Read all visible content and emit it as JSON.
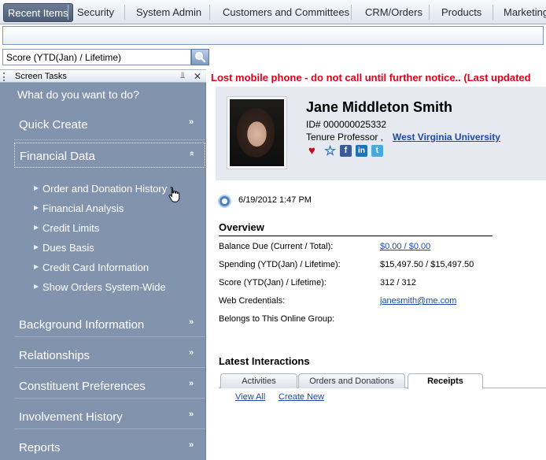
{
  "nav": {
    "tabs": [
      {
        "label": "Recent Items",
        "active": true
      },
      {
        "label": "Security"
      },
      {
        "label": "System Admin"
      },
      {
        "label": "Customers and Committees"
      },
      {
        "label": "CRM/Orders"
      },
      {
        "label": "Products"
      },
      {
        "label": "Marketing"
      }
    ]
  },
  "search": {
    "value": "Score (YTD(Jan) / Lifetime)",
    "icon": "search-icon"
  },
  "tasks": {
    "title": "Screen Tasks",
    "prompt": "What do you want to do?",
    "sections": [
      {
        "label": "Quick Create",
        "expanded": false
      },
      {
        "label": "Financial Data",
        "expanded": true,
        "items": [
          "Order and Donation History",
          "Financial Analysis",
          "Credit Limits",
          "Dues Basis",
          "Credit Card Information",
          "Show Orders System-Wide"
        ]
      },
      {
        "label": "Background Information",
        "expanded": false
      },
      {
        "label": "Relationships",
        "expanded": false
      },
      {
        "label": "Constituent Preferences",
        "expanded": false
      },
      {
        "label": "Involvement History",
        "expanded": false
      },
      {
        "label": "Reports",
        "expanded": false
      }
    ]
  },
  "alert": "Lost mobile phone - do not call until further notice.. (Last updated",
  "profile": {
    "name": "Jane Middleton Smith",
    "id_line": "ID# 000000025332",
    "title_line": "Tenure Professor ,",
    "organization": "West Virginia University",
    "social_icons": [
      "heart-icon",
      "star-icon",
      "facebook-icon",
      "linkedin-icon",
      "twitter-icon"
    ]
  },
  "last_updated": "6/19/2012 1:47 PM",
  "overview": {
    "title": "Overview",
    "rows": [
      {
        "label": "Balance Due (Current / Total):",
        "value": "$0.00 / $0.00",
        "link": true
      },
      {
        "label": "Spending (YTD(Jan) / Lifetime):",
        "value": "$15,497.50 / $15,497.50"
      },
      {
        "label": "Score (YTD(Jan) / Lifetime):",
        "value": "312 / 312"
      },
      {
        "label": "Web Credentials:",
        "value": "janesmith@me.com",
        "link": true
      },
      {
        "label": "Belongs to This Online Group:",
        "value": ""
      }
    ]
  },
  "interactions": {
    "title": "Latest Interactions",
    "tabs": [
      {
        "label": "Activities"
      },
      {
        "label": "Orders and Donations"
      },
      {
        "label": "Receipts",
        "active": true
      }
    ],
    "view_all": "View All",
    "create_new": "Create New"
  },
  "colors": {
    "panel": "#8293ae",
    "alert": "#e0001b",
    "link": "#1d4aa8"
  }
}
